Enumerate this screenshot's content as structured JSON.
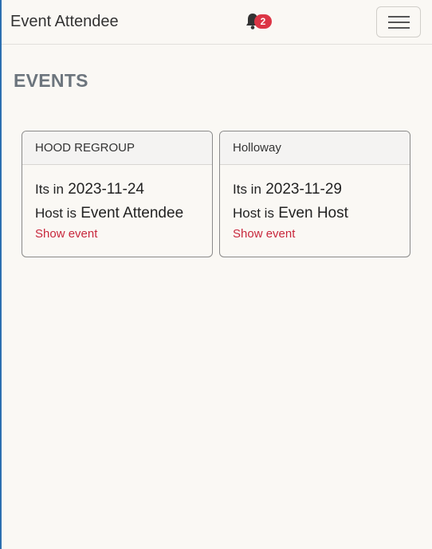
{
  "navbar": {
    "brand": "Event Attendee",
    "notification_count": "2"
  },
  "page": {
    "title": "EVENTS"
  },
  "events": [
    {
      "name": "HOOD REGROUP",
      "date_prefix": "Its in",
      "date": "2023-11-24",
      "host_prefix": "Host is",
      "host": "Event Attendee",
      "link": "Show event"
    },
    {
      "name": "Holloway",
      "date_prefix": "Its in",
      "date": "2023-11-29",
      "host_prefix": "Host is",
      "host": "Even Host",
      "link": "Show event"
    }
  ],
  "colors": {
    "accent": "#c8273c",
    "badge": "#dc3545",
    "background": "#faf8f4"
  }
}
